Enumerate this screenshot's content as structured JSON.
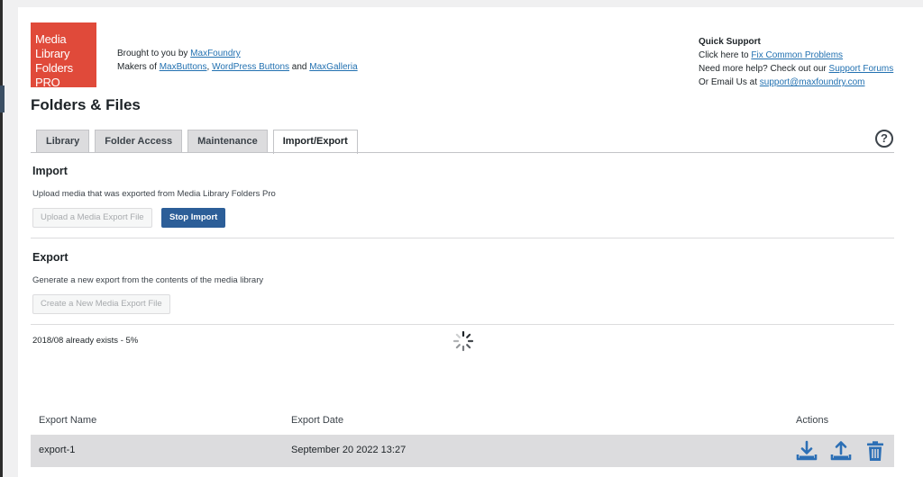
{
  "logo": {
    "lines": [
      "Media",
      "Library",
      "Folders PRO"
    ]
  },
  "header": {
    "brought_prefix": "Brought to you by ",
    "brought_link": "MaxFoundry",
    "makers_prefix": "Makers of ",
    "makers_link1": "MaxButtons",
    "comma": ", ",
    "makers_link2": "WordPress Buttons",
    "and": " and ",
    "makers_link3": "MaxGalleria"
  },
  "support": {
    "title": "Quick Support",
    "line1_prefix": "Click here to ",
    "line1_link": "Fix Common Problems",
    "line2_prefix": "Need more help? Check out our ",
    "line2_link": "Support Forums",
    "line3_prefix": "Or Email Us at ",
    "line3_link": "support@maxfoundry.com"
  },
  "page_title": "Folders & Files",
  "tabs": [
    {
      "label": "Library",
      "active": false
    },
    {
      "label": "Folder Access",
      "active": false
    },
    {
      "label": "Maintenance",
      "active": false
    },
    {
      "label": "Import/Export",
      "active": true
    }
  ],
  "help_icon": "?",
  "import": {
    "title": "Import",
    "desc": "Upload media that was exported from Media Library Folders Pro",
    "upload_button": "Upload a Media Export File",
    "stop_button": "Stop Import"
  },
  "export": {
    "title": "Export",
    "desc": "Generate a new export from the contents of the media library",
    "create_button": "Create a New Media Export File"
  },
  "status_text": "2018/08 already exists - 5%",
  "table": {
    "headers": {
      "name": "Export Name",
      "date": "Export Date",
      "actions": "Actions"
    },
    "rows": [
      {
        "name": "export-1",
        "date": "September 20 2022 13:27"
      }
    ]
  },
  "icons": {
    "download": "download-icon",
    "upload": "upload-icon",
    "trash": "trash-icon",
    "color": "#2c6fb5"
  }
}
